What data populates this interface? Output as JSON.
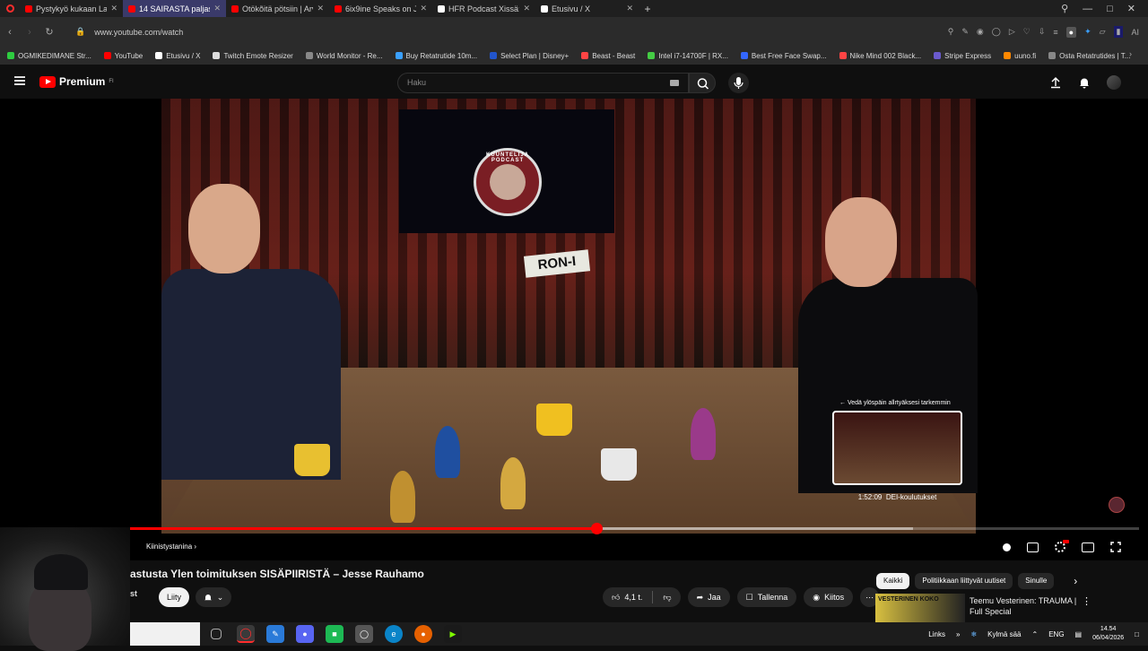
{
  "browser": {
    "tabs": [
      {
        "label": "Pystykyö kukaan Lahdess",
        "color": "#ff0000",
        "active": false
      },
      {
        "label": "14 SAIRASTA paljastusta Yl",
        "color": "#ff0000",
        "active": true
      },
      {
        "label": "Otökõitä pötsiin | Arvosta",
        "color": "#ff0000",
        "active": false
      },
      {
        "label": "6ix9ine Speaks on Jail with",
        "color": "#ff0000",
        "active": false
      },
      {
        "label": "HFR Podcast Xissä: \"Pep",
        "color": "#ffffff",
        "active": false
      },
      {
        "label": "Etusivu / X",
        "color": "#ffffff",
        "active": false
      }
    ],
    "new_tab": "+",
    "url": "www.youtube.com/watch",
    "ai_label": "AI",
    "bookmarks": [
      {
        "label": "OGMIKEDIMANE Str...",
        "color": "#2ecc40"
      },
      {
        "label": "YouTube",
        "color": "#ff0000"
      },
      {
        "label": "Etusivu / X",
        "color": "#ffffff"
      },
      {
        "label": "Twitch Emote Resizer",
        "color": "#dddddd"
      },
      {
        "label": "World Monitor - Re...",
        "color": "#888888"
      },
      {
        "label": "Buy Retatrutide 10m...",
        "color": "#3aa0ff"
      },
      {
        "label": "Select Plan | Disney+",
        "color": "#2255cc"
      },
      {
        "label": "Beast - Beast",
        "color": "#ff4444"
      },
      {
        "label": "Intel i7-14700F | RX...",
        "color": "#44cc44"
      },
      {
        "label": "Best Free Face Swap...",
        "color": "#3366ff"
      },
      {
        "label": "Nike Mind 002 Black...",
        "color": "#ff4444"
      },
      {
        "label": "Stripe Express",
        "color": "#6a5acd"
      },
      {
        "label": "uuno.fi",
        "color": "#ff8800"
      },
      {
        "label": "Osta Retatrutides | T...",
        "color": "#888888"
      }
    ]
  },
  "youtube": {
    "logo_text": "Premium",
    "logo_sup": "FI",
    "search_placeholder": "Haku"
  },
  "video": {
    "podcast_logo_text": "KUUNTELIJA PODCAST",
    "sign_text": "RON-I",
    "preview_hint": "← Vedä ylöspäin allrtyäksesi tarkemmin",
    "preview_time": "1:52:09",
    "preview_chapter": "DEI-koulutukset",
    "progress_played": 0.52,
    "progress_buffered": 0.8,
    "chapter_label": "Kiinistystanina ›"
  },
  "info": {
    "title": "astusta Ylen toimituksen SISÄPIIRISTÄ – Jesse Rauhamo",
    "channel_fragment": "st",
    "join_label": "Liity",
    "like_count": "4,1 t.",
    "share_label": "Jaa",
    "save_label": "Tallenna",
    "thanks_label": "Kiitos",
    "more": "⋯"
  },
  "sidebar": {
    "chips": [
      "Kaikki",
      "Politiikkaan liittyvät uutiset",
      "Sinulle"
    ],
    "rec_thumb_text": "VESTERINEN KOKO",
    "rec_title": "Teemu Vesterinen: TRAUMA | Full Special"
  },
  "taskbar": {
    "links_label": "Links",
    "weather": "Kylmä sää",
    "lang": "ENG",
    "time": "14.54",
    "date": "06/04/2026"
  }
}
